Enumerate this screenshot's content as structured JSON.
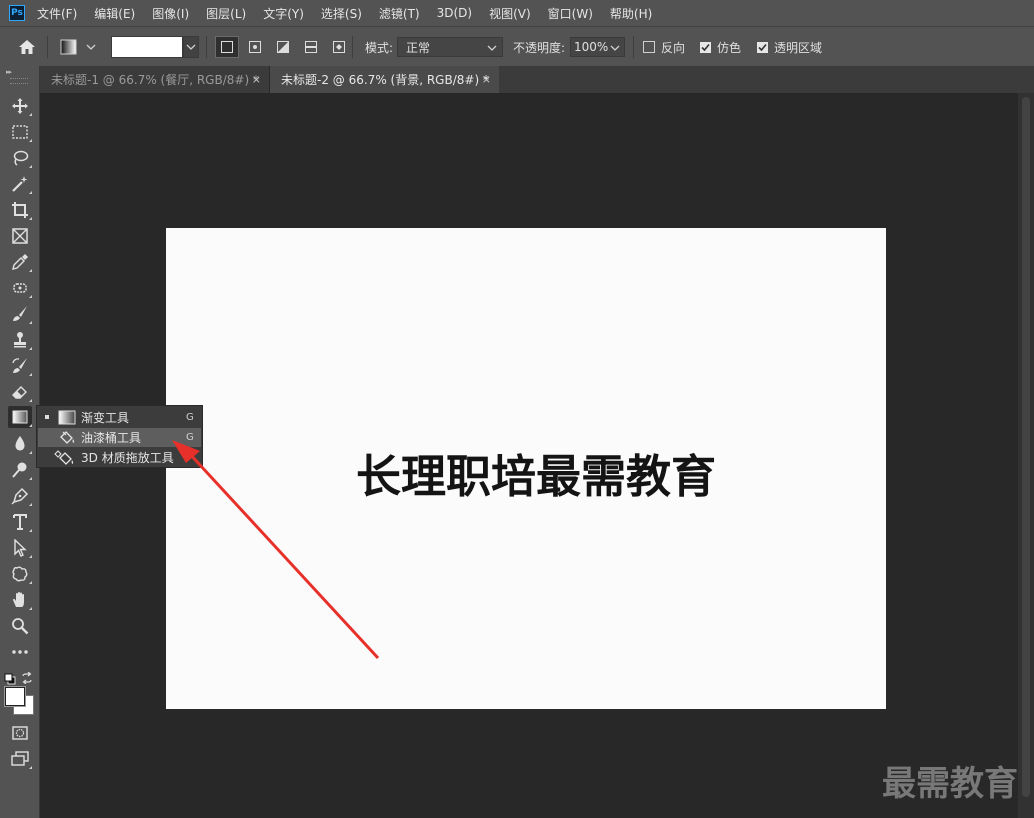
{
  "menubar": {
    "logo": "Ps",
    "items": [
      "文件(F)",
      "编辑(E)",
      "图像(I)",
      "图层(L)",
      "文字(Y)",
      "选择(S)",
      "滤镜(T)",
      "3D(D)",
      "视图(V)",
      "窗口(W)",
      "帮助(H)"
    ]
  },
  "options": {
    "mode_label": "模式:",
    "mode_value": "正常",
    "opacity_label": "不透明度:",
    "opacity_value": "100%",
    "reverse_label": "反向",
    "dither_label": "仿色",
    "transparency_label": "透明区域",
    "reverse_checked": false,
    "dither_checked": true,
    "transparency_checked": true
  },
  "tabs": [
    {
      "title": "未标题-1 @ 66.7% (餐厅, RGB/8#) *",
      "close": "×",
      "active": false
    },
    {
      "title": "未标题-2 @ 66.7% (背景, RGB/8#) *",
      "close": "×",
      "active": true
    }
  ],
  "flyout": [
    {
      "label": "渐变工具",
      "key": "G",
      "icon": "gradient-icon",
      "current": true
    },
    {
      "label": "油漆桶工具",
      "key": "G",
      "icon": "paint-bucket-icon",
      "hover": true
    },
    {
      "label": "3D 材质拖放工具",
      "key": "G",
      "icon": "3d-material-drop-icon"
    }
  ],
  "document": {
    "text": "长理职培最需教育"
  },
  "watermark": "最需教育",
  "colors": {
    "accent": "#31a8ff",
    "arrow": "#e8302a"
  }
}
